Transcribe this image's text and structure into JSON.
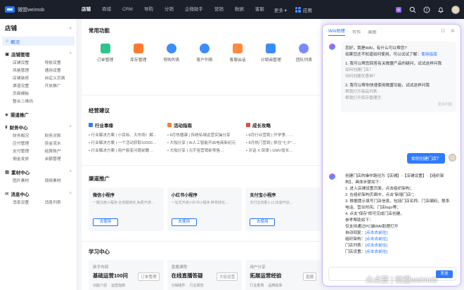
{
  "header": {
    "logo_text": "微盟weimob",
    "nav": [
      "店铺",
      "商城",
      "CRM",
      "导购",
      "分销",
      "企微助手",
      "营销",
      "数据",
      "客服"
    ],
    "more": "更多",
    "apps": "应用"
  },
  "sidebar": {
    "title": "店铺",
    "overview": "概况",
    "sections": [
      {
        "title": "店铺管理",
        "items": [
          "店铺设置",
          "导航设置",
          "风格管理",
          "通用设置",
          "店铺装修",
          "自定义页面",
          "渠道设置",
          "开放推广",
          "页面模板",
          "",
          "整合二维码",
          ""
        ]
      },
      {
        "title": "渠道推广",
        "items": []
      },
      {
        "title": "财务中心",
        "items": [
          "财务概况",
          "财务对账",
          "应付管理",
          "资金流水",
          "支付管理",
          "结算账户",
          "佣金发放",
          "余额管理"
        ]
      },
      {
        "title": "素材中心",
        "items": [
          "图片素材",
          "视频素材"
        ]
      },
      {
        "title": "消息中心",
        "items": [
          "消息设置",
          "消息列表"
        ]
      }
    ]
  },
  "main": {
    "common_title": "常用功能",
    "functions": [
      "订单管理",
      "库存管理",
      "导购列表",
      "客户列表",
      "客服会话",
      "分销商管理",
      "团队列表"
    ],
    "advice_title": "经营建议",
    "advice": [
      {
        "title": "行业事缘",
        "color": "#2f7bff",
        "lines": [
          "• 行业解决方案 | 小目标、大市场！解…",
          "• 行业解决方案 | 一个活动获取10000…",
          "• 行业解决方案 | 用户裂变问题前瞻…"
        ]
      },
      {
        "title": "活动指南",
        "color": "#ff7a2f",
        "lines": [
          "• 8月热播课 | 传统私域运营实操分享",
          "• 大咖分享 | AI人工智能开启电商新纪元",
          "• 大咖分享 | 元宇宙营销新零售…"
        ]
      },
      {
        "title": "成长攻略",
        "color": "#e64848",
        "lines": [
          "• 8月行业营销 | 开学季……",
          "• 8月热门营销 | 抓住\"七夕\"…",
          "• 对话 X 保律 | GMV增长…"
        ]
      }
    ],
    "channel_title": "渠道推广",
    "channels": [
      {
        "title": "微信小程序",
        "desc": "一键注册小程序,全流程绑定,免费开通…",
        "btn": "去使用"
      },
      {
        "title": "小红书小程序",
        "desc": "一站式开通小红书小程序,种草转化…",
        "btn": "去使用"
      },
      {
        "title": "支付宝小程序",
        "desc": "支付宝流量入口,快速开店…",
        "btn": "去使用"
      }
    ],
    "learn_title": "学习中心",
    "learns": [
      {
        "sub": "新手布局",
        "title": "基础运营100问",
        "tags": [
          "功能介绍",
          "运营指南"
        ],
        "badge": "订单管理"
      },
      {
        "sub": "直播课程",
        "title": "在线直播答疑",
        "tags": [
          "分销组件",
          "行业报告"
        ],
        "badge": "大促运营"
      },
      {
        "sub": "用户分享",
        "title": "拓展运营经验",
        "tags": [
          "行业案例",
          "品牌故事"
        ],
        "badge": "直播"
      }
    ]
  },
  "assistant": {
    "tabs": [
      "WAI助理",
      "写作",
      "画图"
    ],
    "greeting": "您好，我是WAI，有什么可以帮您?",
    "greeting2": "如果您还不知道如何使用，可以试试了解：",
    "greeting_link": "使用指南",
    "q1": "1. 我可以帮您回答有关微盟产品的疑问，试试这样问我",
    "q1_a": "如何创建门店？",
    "q1_b": "如何创建优惠券？",
    "q2": "2. 我可以帮你快速使用微盟功能，试试这样问我",
    "q2_a": "帮我打开商品列表",
    "q2_b": "帮我打开库存管理页",
    "feedback": "更多问题",
    "user_msg": "如何创建门店？",
    "answer_head": "创建门店的操作路径为【店铺】-【店铺设置】-【组织架构】，具体步骤如下：",
    "answer_steps": [
      "1. 进入店铺设置页面，点击组织架构；",
      "2. 在组织架构页面中，点击“新增门店”；",
      "3. 根据提示填写门店信息，包括门店名称、门店编码、联系电话、营业时间、门店logo等；",
      "4. 点击“保存”即可完成门店创建。"
    ],
    "help_title": "参考帮助如下：",
    "help_sub": "仅支持通过PC端WAI助理打开",
    "help_items": [
      {
        "label": "自动回复：",
        "link": "[点击去前往]"
      },
      {
        "label": "组织架构：",
        "link": "[点击去前往]"
      },
      {
        "label": "门店列表：",
        "link": "[点击去前往]"
      },
      {
        "label": "门店设置：",
        "link": "[点击去前往]"
      }
    ],
    "input_placeholder": "",
    "send": "发送"
  },
  "watermark": "众点营 | 微盟weimob",
  "colors": {
    "accent": "#2f7bff",
    "topbar": "#1b1f2a",
    "assistant_border": "#c9b7f5"
  }
}
